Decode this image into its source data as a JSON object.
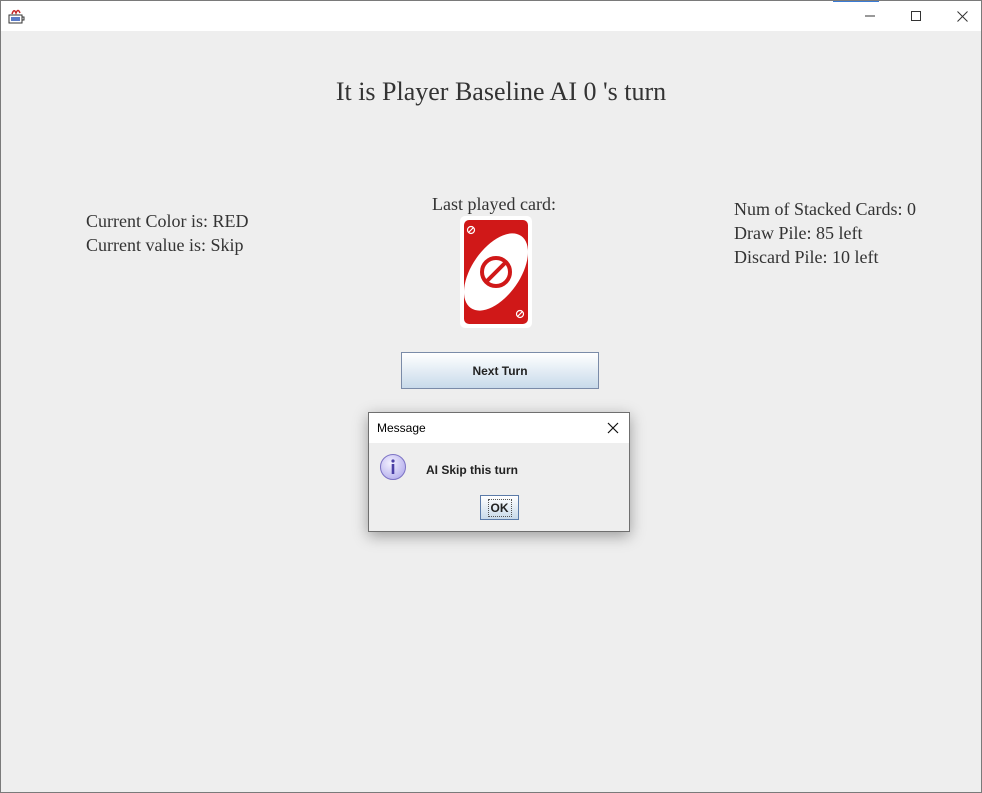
{
  "window": {
    "app_icon": "java-cup-icon",
    "controls": {
      "minimize": "minimize-icon",
      "maximize": "maximize-icon",
      "close": "close-icon"
    }
  },
  "game": {
    "turn_title": "It is Player Baseline AI 0 's turn",
    "current_color": "Current Color is: RED",
    "current_value": "Current value is: Skip",
    "last_played_label": "Last played card:",
    "last_card": {
      "color": "#d01818",
      "value": "Skip",
      "icon": "skip-icon"
    },
    "stacked_cards": "Num of Stacked Cards: 0",
    "draw_pile": "Draw Pile: 85 left",
    "discard_pile": "Discard Pile: 10 left",
    "next_turn_label": "Next Turn"
  },
  "dialog": {
    "title": "Message",
    "icon": "info-icon",
    "message": "AI Skip this turn",
    "ok_label": "OK"
  },
  "colors": {
    "background": "#eeeeee",
    "card_red": "#d01818",
    "button_gradient_bottom": "#c8daea"
  }
}
